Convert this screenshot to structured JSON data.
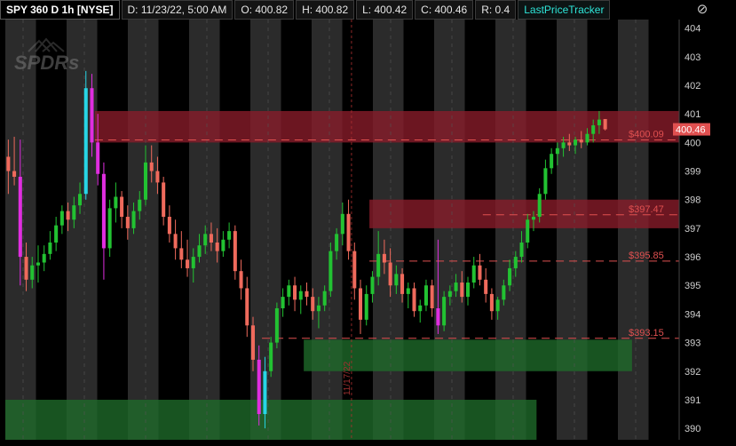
{
  "header": {
    "symbol": "SPY 360 D 1h [NYSE]",
    "date": "D: 11/23/22, 5:00 AM",
    "open": "O: 400.82",
    "high": "H: 400.82",
    "low": "L: 400.42",
    "close": "C: 400.46",
    "range": "R: 0.4",
    "study": "LastPriceTracker"
  },
  "close_icon": "close-icon",
  "logo": "SPDRs",
  "colors": {
    "background": "#000000",
    "session_shade": "#2b2b2b",
    "up_candle": "#22c232",
    "down_candle": "#ef6a5c",
    "magenta": "#e02ee0",
    "cyan": "#27d6e6",
    "resistance_zone": "#8a1c2a",
    "support_zone": "#1f6b2a",
    "level_line": "#e05050",
    "price_badge": "#e05050"
  },
  "chart_data": {
    "type": "candlestick",
    "ylim": [
      389.6,
      404.3
    ],
    "y_ticks": [
      "404",
      "403",
      "402",
      "401",
      "400",
      "399",
      "398",
      "397",
      "396",
      "395",
      "394",
      "393",
      "392",
      "391",
      "390"
    ],
    "last_price": "400.46",
    "levels": [
      {
        "label": "$400.09",
        "value": 400.09
      },
      {
        "label": "$397.47",
        "value": 397.47
      },
      {
        "label": "$395.85",
        "value": 395.85
      },
      {
        "label": "$393.15",
        "value": 393.15
      }
    ],
    "zones": [
      {
        "kind": "resistance",
        "from_bar": 15,
        "to_bar": 130,
        "low": 400.0,
        "high": 401.1
      },
      {
        "kind": "resistance",
        "from_bar": 61,
        "to_bar": 124,
        "low": 397.0,
        "high": 398.0
      },
      {
        "kind": "support",
        "from_bar": 50,
        "to_bar": 105,
        "low": 392.0,
        "high": 393.1
      },
      {
        "kind": "support",
        "from_bar": 0,
        "to_bar": 89,
        "low": 389.6,
        "high": 391.0
      }
    ],
    "day_marker": "11/17/22",
    "candles": [
      [
        399.5,
        400.1,
        398.2,
        399.0
      ],
      [
        399.0,
        400.2,
        398.5,
        398.8
      ],
      [
        398.8,
        400.1,
        395.0,
        396.0
      ],
      [
        396.0,
        396.5,
        394.8,
        395.2
      ],
      [
        395.2,
        396.0,
        394.9,
        395.7
      ],
      [
        395.7,
        396.4,
        395.1,
        395.8
      ],
      [
        395.8,
        396.4,
        395.5,
        396.1
      ],
      [
        396.1,
        396.9,
        395.9,
        396.5
      ],
      [
        396.5,
        397.4,
        396.2,
        397.1
      ],
      [
        397.1,
        397.8,
        396.8,
        397.6
      ],
      [
        397.6,
        397.9,
        396.9,
        397.3
      ],
      [
        397.3,
        398.1,
        397.0,
        397.8
      ],
      [
        397.8,
        398.6,
        397.5,
        398.2
      ],
      [
        398.2,
        402.5,
        398.0,
        401.9
      ],
      [
        401.9,
        402.4,
        399.5,
        400.0
      ],
      [
        400.0,
        401.0,
        398.5,
        398.9
      ],
      [
        398.9,
        399.3,
        395.2,
        396.3
      ],
      [
        396.3,
        398.0,
        396.0,
        397.7
      ],
      [
        397.7,
        398.6,
        397.2,
        398.1
      ],
      [
        398.1,
        398.3,
        397.0,
        397.4
      ],
      [
        397.4,
        397.8,
        396.6,
        397.0
      ],
      [
        397.0,
        397.9,
        396.8,
        397.6
      ],
      [
        397.6,
        398.3,
        397.3,
        398.0
      ],
      [
        398.0,
        399.9,
        397.8,
        399.3
      ],
      [
        399.3,
        399.9,
        398.6,
        399.0
      ],
      [
        399.0,
        399.5,
        398.2,
        398.6
      ],
      [
        398.6,
        398.8,
        397.1,
        397.4
      ],
      [
        397.4,
        397.8,
        396.5,
        396.8
      ],
      [
        396.8,
        397.3,
        395.9,
        396.3
      ],
      [
        396.3,
        396.9,
        395.6,
        395.9
      ],
      [
        395.9,
        396.6,
        395.3,
        395.6
      ],
      [
        395.6,
        396.3,
        395.1,
        396.0
      ],
      [
        396.0,
        396.8,
        395.8,
        396.4
      ],
      [
        396.4,
        397.1,
        396.1,
        396.8
      ],
      [
        396.8,
        397.2,
        396.2,
        396.5
      ],
      [
        396.5,
        397.0,
        395.8,
        396.2
      ],
      [
        396.2,
        396.9,
        396.0,
        396.6
      ],
      [
        396.6,
        397.2,
        396.3,
        396.9
      ],
      [
        396.9,
        397.1,
        395.2,
        395.5
      ],
      [
        395.5,
        395.9,
        394.5,
        394.9
      ],
      [
        394.9,
        395.3,
        393.2,
        393.6
      ],
      [
        393.6,
        393.9,
        392.0,
        392.4
      ],
      [
        392.4,
        392.9,
        390.1,
        390.5
      ],
      [
        390.5,
        392.5,
        390.0,
        392.0
      ],
      [
        392.0,
        393.2,
        391.8,
        393.0
      ],
      [
        393.0,
        394.4,
        392.8,
        394.2
      ],
      [
        394.2,
        394.9,
        393.9,
        394.6
      ],
      [
        394.6,
        395.2,
        394.3,
        395.0
      ],
      [
        395.0,
        395.3,
        394.1,
        394.5
      ],
      [
        394.5,
        395.0,
        394.0,
        394.8
      ],
      [
        394.8,
        395.1,
        394.3,
        394.6
      ],
      [
        394.6,
        394.9,
        393.8,
        394.1
      ],
      [
        394.1,
        394.6,
        393.5,
        394.3
      ],
      [
        394.3,
        395.0,
        394.1,
        394.8
      ],
      [
        394.8,
        396.5,
        394.6,
        396.2
      ],
      [
        396.2,
        397.0,
        395.9,
        396.8
      ],
      [
        396.8,
        397.9,
        396.4,
        397.5
      ],
      [
        397.5,
        398.0,
        395.9,
        396.2
      ],
      [
        396.2,
        396.5,
        394.5,
        394.9
      ],
      [
        394.9,
        395.2,
        393.3,
        393.8
      ],
      [
        393.8,
        395.0,
        393.6,
        394.7
      ],
      [
        394.7,
        395.5,
        394.4,
        395.3
      ],
      [
        395.3,
        396.9,
        395.0,
        396.1
      ],
      [
        396.1,
        396.6,
        395.4,
        395.8
      ],
      [
        395.8,
        396.3,
        394.6,
        395.0
      ],
      [
        395.0,
        395.7,
        394.7,
        395.4
      ],
      [
        395.4,
        395.6,
        394.4,
        394.7
      ],
      [
        394.7,
        395.1,
        394.2,
        394.9
      ],
      [
        394.9,
        395.1,
        393.9,
        394.1
      ],
      [
        394.1,
        394.5,
        393.7,
        394.3
      ],
      [
        394.3,
        395.2,
        394.1,
        395.0
      ],
      [
        395.0,
        395.2,
        393.9,
        394.2
      ],
      [
        394.2,
        396.6,
        393.3,
        393.6
      ],
      [
        393.6,
        394.8,
        393.4,
        394.6
      ],
      [
        394.6,
        395.0,
        394.3,
        394.8
      ],
      [
        394.8,
        395.4,
        394.6,
        395.1
      ],
      [
        395.1,
        395.5,
        394.4,
        394.6
      ],
      [
        394.6,
        395.3,
        394.3,
        395.1
      ],
      [
        395.1,
        396.0,
        394.9,
        395.7
      ],
      [
        395.7,
        396.1,
        395.0,
        395.2
      ],
      [
        395.2,
        395.6,
        394.4,
        394.7
      ],
      [
        394.7,
        394.9,
        393.8,
        394.1
      ],
      [
        394.1,
        394.6,
        393.8,
        394.5
      ],
      [
        394.5,
        395.2,
        394.3,
        395.0
      ],
      [
        395.0,
        395.9,
        394.8,
        395.6
      ],
      [
        395.6,
        396.2,
        395.3,
        396.0
      ],
      [
        396.0,
        396.9,
        395.8,
        396.5
      ],
      [
        396.5,
        397.5,
        396.3,
        397.3
      ],
      [
        397.3,
        397.6,
        396.9,
        397.4
      ],
      [
        397.4,
        398.4,
        397.2,
        398.2
      ],
      [
        398.2,
        399.4,
        398.0,
        399.1
      ],
      [
        399.1,
        399.8,
        398.9,
        399.6
      ],
      [
        399.6,
        400.0,
        399.2,
        399.8
      ],
      [
        399.8,
        400.2,
        399.5,
        400.0
      ],
      [
        400.0,
        400.3,
        399.7,
        399.9
      ],
      [
        399.9,
        400.2,
        399.6,
        400.1
      ],
      [
        400.1,
        400.4,
        399.8,
        400.0
      ],
      [
        400.0,
        400.5,
        399.9,
        400.3
      ],
      [
        400.3,
        400.8,
        400.0,
        400.6
      ],
      [
        400.6,
        401.1,
        400.3,
        400.8
      ],
      [
        400.82,
        400.82,
        400.42,
        400.46
      ]
    ]
  }
}
